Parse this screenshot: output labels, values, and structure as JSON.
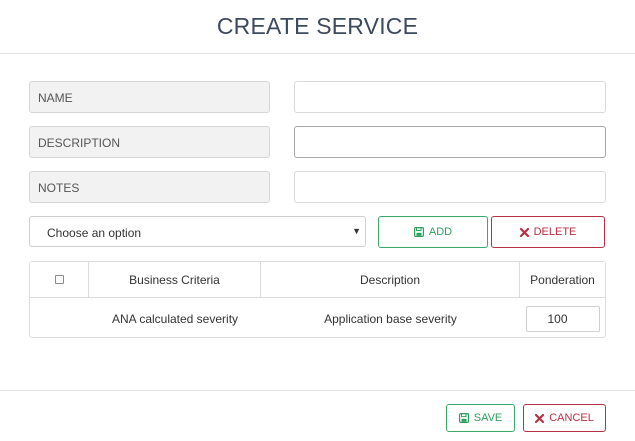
{
  "dialog": {
    "title": "CREATE SERVICE"
  },
  "form": {
    "name_label": "NAME",
    "name_value": "",
    "description_label": "DESCRIPTION",
    "description_value": "",
    "notes_label": "NOTES",
    "notes_value": ""
  },
  "criteria_select": {
    "selected": "Choose an option"
  },
  "actions": {
    "add_label": "ADD",
    "delete_label": "DELETE"
  },
  "table": {
    "headers": [
      "",
      "Business Criteria",
      "Description",
      "Ponderation"
    ],
    "rows": [
      {
        "business_criteria": "ANA calculated severity",
        "description": "Application base severity",
        "ponderation": "100"
      }
    ]
  },
  "footer": {
    "save_label": "SAVE",
    "cancel_label": "CANCEL"
  },
  "colors": {
    "title": "#3c4a5e",
    "success": "#2e9e5e",
    "danger": "#b43246"
  },
  "icons": {
    "add": "save-icon",
    "delete": "close-icon",
    "save": "save-icon",
    "cancel": "close-icon",
    "select": "caret-down-icon"
  }
}
